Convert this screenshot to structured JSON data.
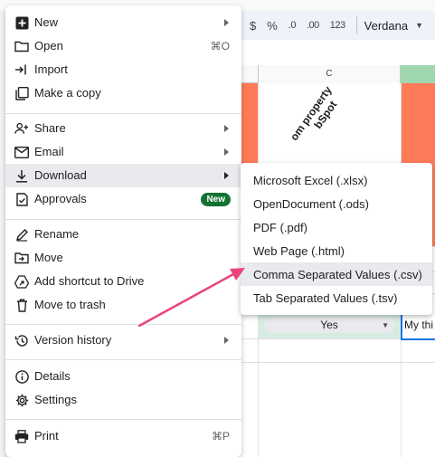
{
  "toolbar": {
    "currency": "$",
    "percent": "%",
    "dec_decrease": ".0",
    "dec_increase": ".00",
    "number_format": "123",
    "font": "Verdana"
  },
  "sheet": {
    "column_c": "C",
    "header_text_line1": "om property",
    "header_text_line2": "bSpot",
    "dropdown_value": "Yes",
    "cell_text": "My thi"
  },
  "menu": {
    "new": "New",
    "open": "Open",
    "open_shortcut": "⌘O",
    "import": "Import",
    "make_copy": "Make a copy",
    "share": "Share",
    "email": "Email",
    "download": "Download",
    "approvals": "Approvals",
    "approvals_badge": "New",
    "rename": "Rename",
    "move": "Move",
    "add_shortcut": "Add shortcut to Drive",
    "move_trash": "Move to trash",
    "version_history": "Version history",
    "details": "Details",
    "settings": "Settings",
    "print": "Print",
    "print_shortcut": "⌘P"
  },
  "download_submenu": [
    "Microsoft Excel (.xlsx)",
    "OpenDocument (.ods)",
    "PDF (.pdf)",
    "Web Page (.html)",
    "Comma Separated Values (.csv)",
    "Tab Separated Values (.tsv)"
  ],
  "colors": {
    "accent_orange": "#ff7a59",
    "badge_green": "#137333",
    "annotation_arrow": "#e8457a",
    "highlight": "#e8eaed"
  },
  "icons": {
    "new": "plus-box-icon",
    "open": "folder-icon",
    "import": "import-arrow-icon",
    "make_copy": "copy-icon",
    "share": "person-add-icon",
    "email": "email-icon",
    "download": "download-icon",
    "approvals": "approvals-icon",
    "rename": "pencil-icon",
    "move": "move-folder-icon",
    "add_shortcut": "drive-shortcut-icon",
    "move_trash": "trash-icon",
    "version_history": "history-icon",
    "details": "info-icon",
    "settings": "gear-icon",
    "print": "printer-icon"
  }
}
